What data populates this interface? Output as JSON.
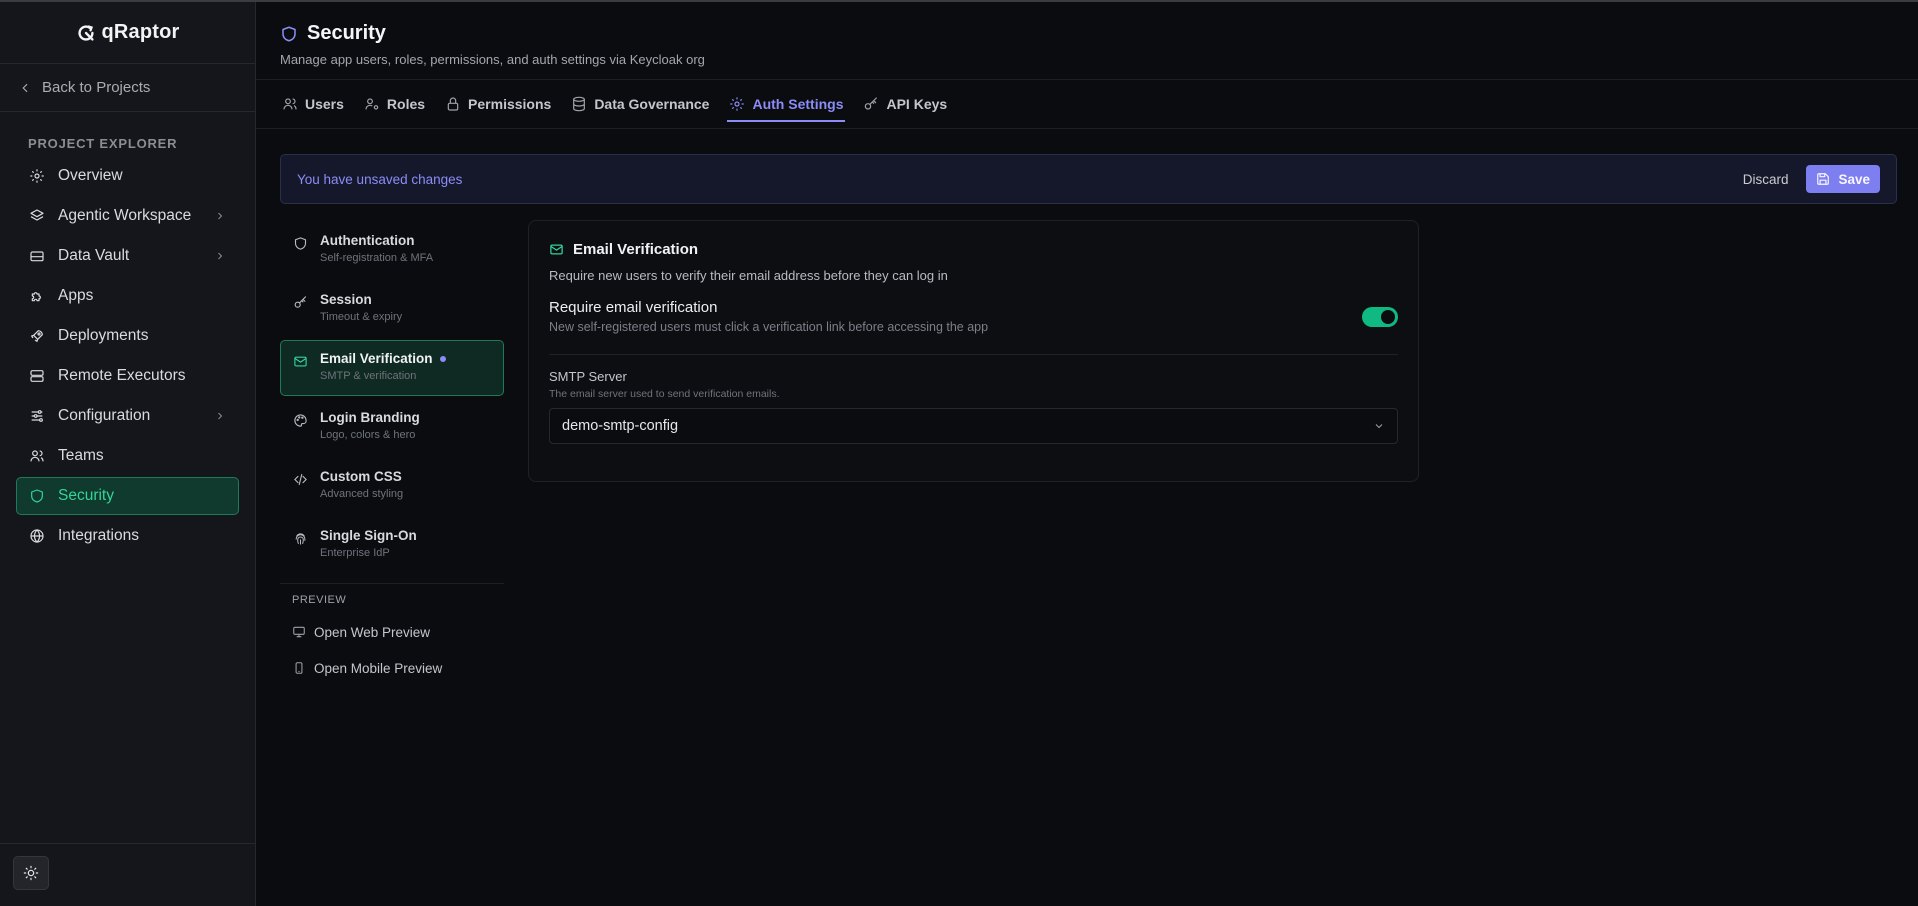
{
  "app": {
    "name": "qRaptor"
  },
  "sidebar": {
    "back_label": "Back to Projects",
    "section_title": "PROJECT EXPLORER",
    "items": [
      {
        "label": "Overview",
        "icon": "gear-icon",
        "has_submenu": false,
        "active": false
      },
      {
        "label": "Agentic Workspace",
        "icon": "layers-icon",
        "has_submenu": true,
        "active": false
      },
      {
        "label": "Data Vault",
        "icon": "drive-icon",
        "has_submenu": true,
        "active": false
      },
      {
        "label": "Apps",
        "icon": "puzzle-icon",
        "has_submenu": false,
        "active": false
      },
      {
        "label": "Deployments",
        "icon": "rocket-icon",
        "has_submenu": false,
        "active": false
      },
      {
        "label": "Remote Executors",
        "icon": "server-icon",
        "has_submenu": false,
        "active": false
      },
      {
        "label": "Configuration",
        "icon": "sliders-icon",
        "has_submenu": true,
        "active": false
      },
      {
        "label": "Teams",
        "icon": "users-icon",
        "has_submenu": false,
        "active": false
      },
      {
        "label": "Security",
        "icon": "shield-icon",
        "has_submenu": false,
        "active": true
      },
      {
        "label": "Integrations",
        "icon": "globe-icon",
        "has_submenu": false,
        "active": false
      }
    ],
    "theme_toggle_icon": "sun-icon"
  },
  "page": {
    "title": "Security",
    "subtitle": "Manage app users, roles, permissions, and auth settings via Keycloak org"
  },
  "tabs": [
    {
      "label": "Users",
      "icon": "users-icon",
      "active": false
    },
    {
      "label": "Roles",
      "icon": "user-cog-icon",
      "active": false
    },
    {
      "label": "Permissions",
      "icon": "lock-icon",
      "active": false
    },
    {
      "label": "Data Governance",
      "icon": "database-icon",
      "active": false
    },
    {
      "label": "Auth Settings",
      "icon": "settings-icon",
      "active": true
    },
    {
      "label": "API Keys",
      "icon": "key-icon",
      "active": false
    }
  ],
  "banner": {
    "message": "You have unsaved changes",
    "discard_label": "Discard",
    "save_label": "Save"
  },
  "settings_nav": {
    "items": [
      {
        "title": "Authentication",
        "subtitle": "Self-registration & MFA",
        "icon": "shield-icon",
        "active": false,
        "modified": false
      },
      {
        "title": "Session",
        "subtitle": "Timeout & expiry",
        "icon": "key-icon",
        "active": false,
        "modified": false
      },
      {
        "title": "Email Verification",
        "subtitle": "SMTP & verification",
        "icon": "mail-icon",
        "active": true,
        "modified": true
      },
      {
        "title": "Login Branding",
        "subtitle": "Logo, colors & hero",
        "icon": "palette-icon",
        "active": false,
        "modified": false
      },
      {
        "title": "Custom CSS",
        "subtitle": "Advanced styling",
        "icon": "code-icon",
        "active": false,
        "modified": false
      },
      {
        "title": "Single Sign-On",
        "subtitle": "Enterprise IdP",
        "icon": "fingerprint-icon",
        "active": false,
        "modified": false
      }
    ],
    "preview_title": "PREVIEW",
    "preview_links": [
      {
        "label": "Open Web Preview",
        "icon": "monitor-icon"
      },
      {
        "label": "Open Mobile Preview",
        "icon": "smartphone-icon"
      }
    ]
  },
  "email_verification": {
    "title": "Email Verification",
    "description": "Require new users to verify their email address before they can log in",
    "toggle_label": "Require email verification",
    "toggle_help": "New self-registered users must click a verification link before accessing the app",
    "toggle_on": true,
    "smtp_label": "SMTP Server",
    "smtp_help": "The email server used to send verification emails.",
    "smtp_value": "demo-smtp-config"
  },
  "colors": {
    "accent_green": "#34d399",
    "accent_purple": "#8b8cf6",
    "background": "#0b0c10",
    "sidebar": "#15161b"
  }
}
